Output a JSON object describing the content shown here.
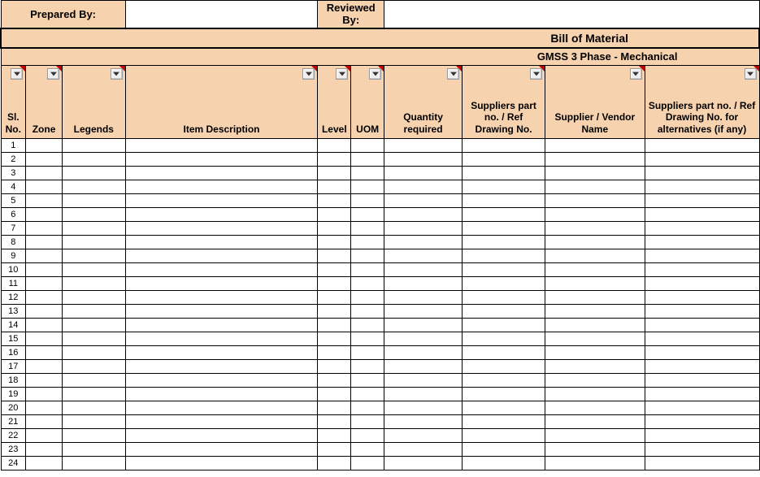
{
  "top": {
    "prepared_by_label": "Prepared By:",
    "prepared_by_value": "",
    "reviewed_by_label": "Reviewed By:",
    "reviewed_by_value": ""
  },
  "title": "Bill of Material",
  "subtitle": "GMSS 3 Phase - Mechanical",
  "columns": {
    "sl_no": "Sl. No.",
    "zone": "Zone",
    "legends": "Legends",
    "item_description": "Item Description",
    "level": "Level",
    "uom": "UOM",
    "quantity_required": "Quantity required",
    "suppliers_part": "Suppliers part no. / Ref Drawing No.",
    "supplier_vendor": "Supplier / Vendor Name",
    "suppliers_alt": "Suppliers part no. / Ref Drawing No. for alternatives (if any)"
  },
  "rows": [
    {
      "sl_no": "1"
    },
    {
      "sl_no": "2"
    },
    {
      "sl_no": "3"
    },
    {
      "sl_no": "4"
    },
    {
      "sl_no": "5"
    },
    {
      "sl_no": "6"
    },
    {
      "sl_no": "7"
    },
    {
      "sl_no": "8"
    },
    {
      "sl_no": "9"
    },
    {
      "sl_no": "10"
    },
    {
      "sl_no": "11"
    },
    {
      "sl_no": "12"
    },
    {
      "sl_no": "13"
    },
    {
      "sl_no": "14"
    },
    {
      "sl_no": "15"
    },
    {
      "sl_no": "16"
    },
    {
      "sl_no": "17"
    },
    {
      "sl_no": "18"
    },
    {
      "sl_no": "19"
    },
    {
      "sl_no": "20"
    },
    {
      "sl_no": "21"
    },
    {
      "sl_no": "22"
    },
    {
      "sl_no": "23"
    },
    {
      "sl_no": "24"
    }
  ]
}
